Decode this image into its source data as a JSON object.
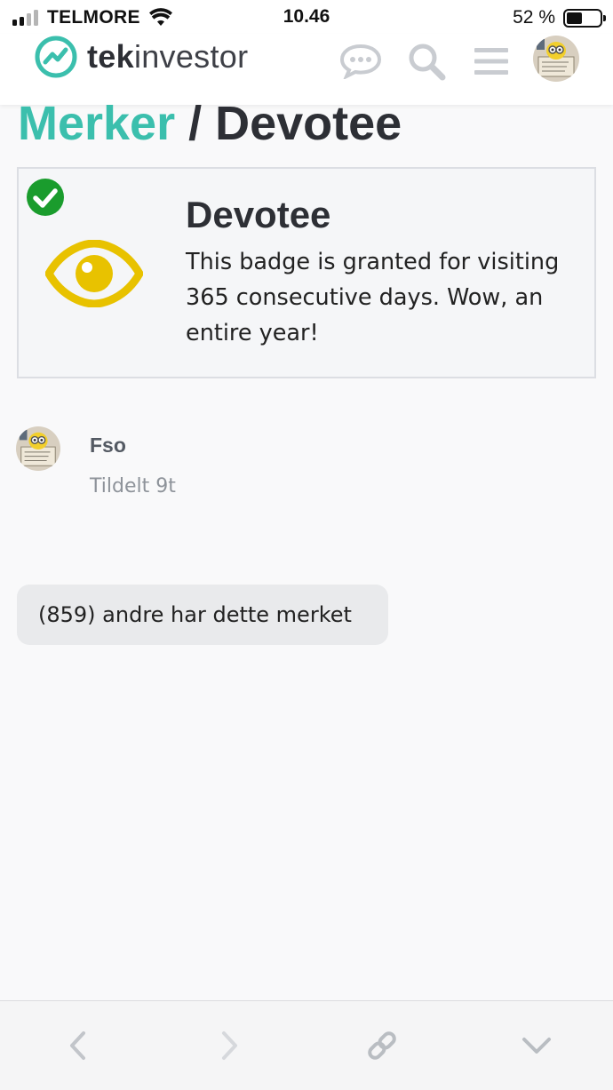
{
  "status_bar": {
    "carrier": "TELMORE",
    "time": "10.46",
    "battery_percent": "52 %",
    "battery_level": 0.52,
    "signal_bars": 4,
    "signal_bars_active": 2
  },
  "header": {
    "logo_bold": "tek",
    "logo_light": "investor",
    "icons": [
      "chat-icon",
      "search-icon",
      "hamburger-menu-icon"
    ],
    "brand_color": "#3bbfad"
  },
  "page": {
    "breadcrumb": "Merker",
    "separator": " / ",
    "title": "Devotee"
  },
  "badge": {
    "name": "Devotee",
    "description": "This badge is granted for visiting 365 consecutive days. Wow, an entire year!",
    "icon": "eye-icon",
    "icon_color": "#e8c200",
    "granted_check_color": "#1a9c2d"
  },
  "grantee": {
    "username": "Fso",
    "granted_time": "Tildelt 9t"
  },
  "others": {
    "label": "(859) andre har dette merket"
  },
  "bottom_bar": {
    "buttons": [
      "back-icon",
      "forward-icon",
      "link-icon",
      "chevron-down-icon"
    ]
  }
}
